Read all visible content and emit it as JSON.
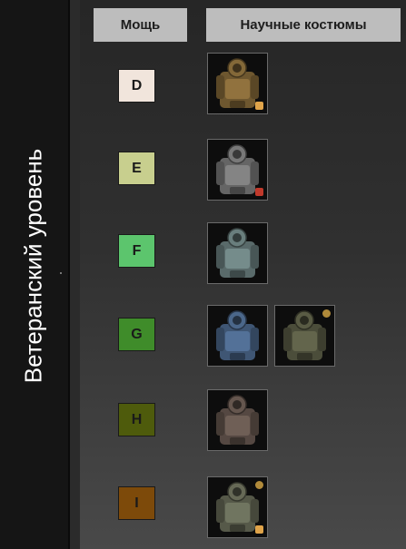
{
  "sidebar": {
    "title": "Ветеранский уровень"
  },
  "columns": {
    "power": "Мощь",
    "suits": "Научные костюмы"
  },
  "tiers": [
    {
      "label": "D",
      "color": "#f1e5dc",
      "text_color": "#1a1a1a"
    },
    {
      "label": "E",
      "color": "#c8cf8e",
      "text_color": "#1a1a1a"
    },
    {
      "label": "F",
      "color": "#5cc56d",
      "text_color": "#1a1a1a"
    },
    {
      "label": "G",
      "color": "#3f8c2a",
      "text_color": "#1a1a1a"
    },
    {
      "label": "H",
      "color": "#4e5b0c",
      "text_color": "#1a1a1a"
    },
    {
      "label": "I",
      "color": "#7d4a0a",
      "text_color": "#1a1a1a"
    }
  ],
  "suits": [
    {
      "tier": "D",
      "icon": "hazard-suit-brown-icon",
      "palette": "#8a6d3b"
    },
    {
      "tier": "E",
      "icon": "hazard-suit-grey-icon",
      "palette": "#7e7e7e"
    },
    {
      "tier": "F",
      "icon": "hazard-suit-teal-icon",
      "palette": "#6f8584"
    },
    {
      "tier": "G",
      "icon": "hazard-suit-blue-icon",
      "palette": "#4f6c91"
    },
    {
      "tier": "G",
      "icon": "hazard-suit-olive-icon",
      "palette": "#5e6048"
    },
    {
      "tier": "H",
      "icon": "hazard-suit-rust-icon",
      "palette": "#6a5a52"
    },
    {
      "tier": "I",
      "icon": "hazard-suit-khaki-icon",
      "palette": "#6b6f5b"
    }
  ]
}
